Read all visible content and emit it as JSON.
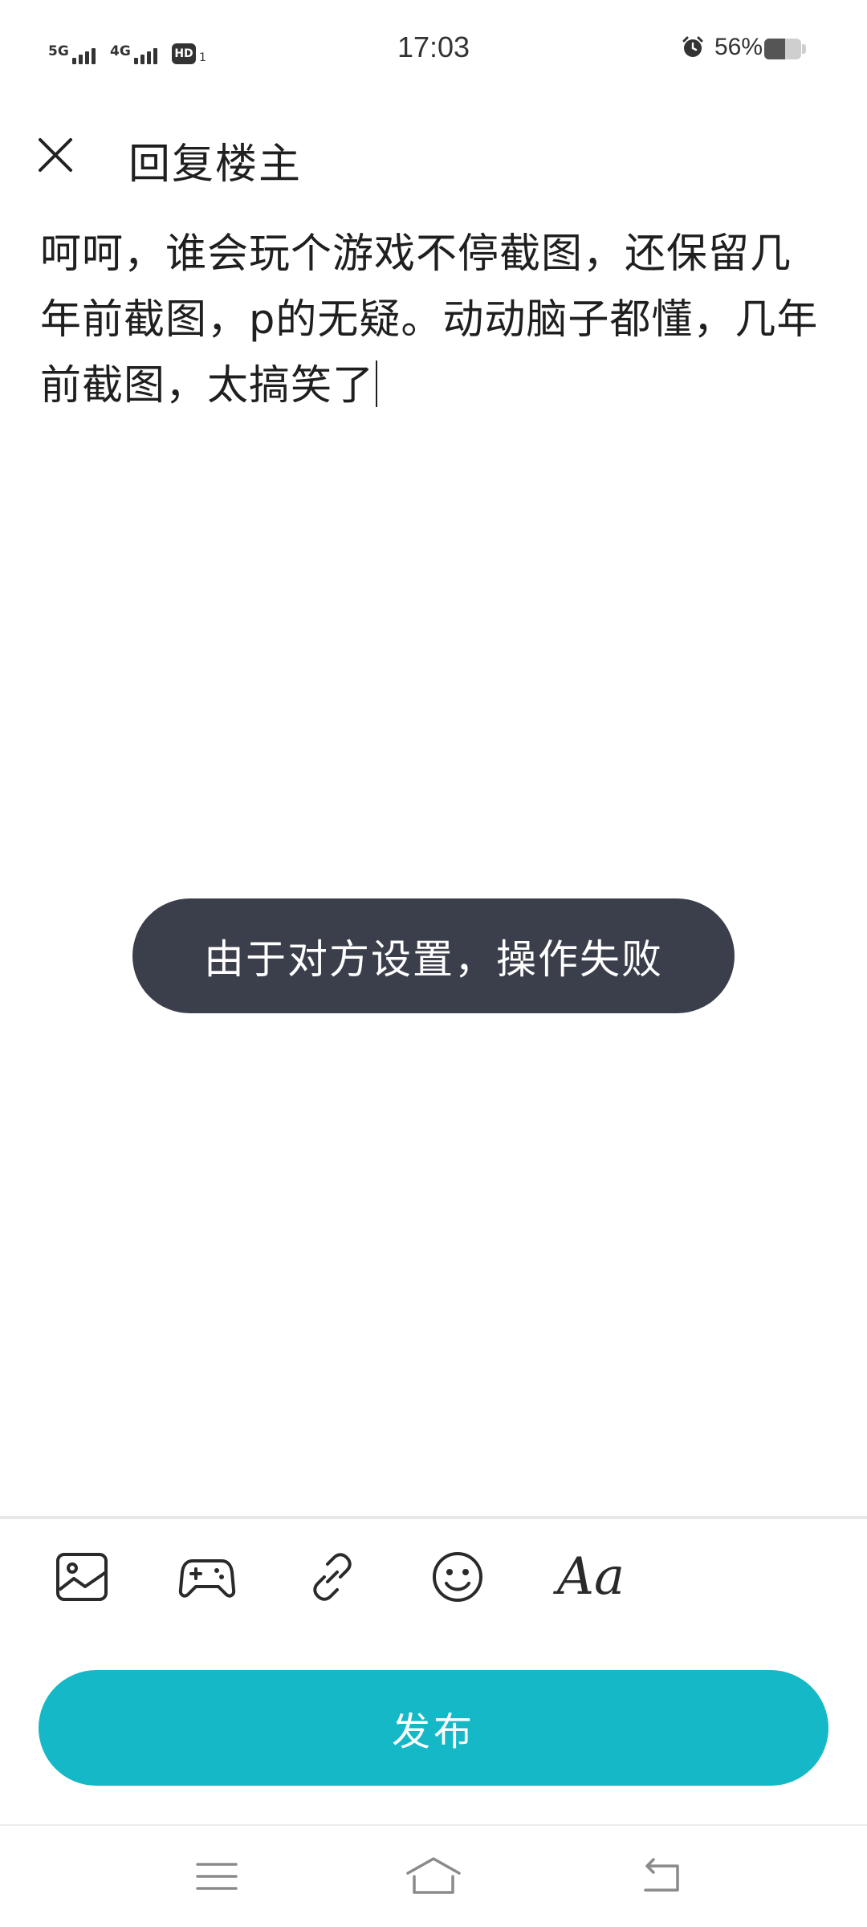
{
  "status_bar": {
    "network1": "5G",
    "network2": "4G",
    "hd_label": "HD",
    "hd_sub": "1",
    "time": "17:03",
    "battery_percent": "56%",
    "battery_level": 0.56,
    "icons": [
      "signal-5g-icon",
      "signal-4g-icon",
      "hd-voice-icon",
      "alarm-icon",
      "battery-icon"
    ]
  },
  "header": {
    "close_icon": "close-icon",
    "title": "回复楼主"
  },
  "editor": {
    "content": "呵呵，谁会玩个游戏不停截图，还保留几年前截图，p的无疑。动动脑子都懂，几年前截图，太搞笑了"
  },
  "toast": {
    "message": "由于对方设置，操作失败"
  },
  "toolbar": {
    "items": [
      {
        "name": "image",
        "icon": "image-icon"
      },
      {
        "name": "game",
        "icon": "gamepad-icon"
      },
      {
        "name": "link",
        "icon": "link-icon"
      },
      {
        "name": "emoji",
        "icon": "emoji-icon"
      },
      {
        "name": "font",
        "icon": "font-icon",
        "label": "Aa"
      }
    ]
  },
  "publish": {
    "label": "发布",
    "color": "#14b8c6"
  },
  "nav_bar": {
    "items": [
      {
        "name": "menu",
        "icon": "menu-icon"
      },
      {
        "name": "home",
        "icon": "home-icon"
      },
      {
        "name": "back",
        "icon": "back-icon"
      }
    ]
  },
  "colors": {
    "toast_bg": "#3b3f4b",
    "accent": "#14b8c6",
    "text": "#1f1f1f"
  }
}
